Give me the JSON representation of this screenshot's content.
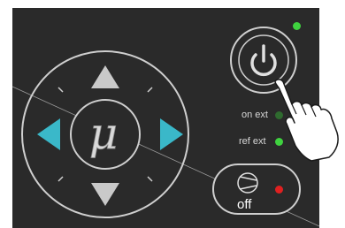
{
  "panel": {
    "background_color": "#2a2a2a",
    "mu_symbol": "μ",
    "indicators": [
      {
        "label": "on ext",
        "led_color": "#2f6b2f",
        "state": "off"
      },
      {
        "label": "ref ext",
        "led_color": "#3fd23f",
        "state": "on"
      }
    ],
    "power_led": {
      "color": "#3fd23f",
      "state": "on"
    },
    "compressor": {
      "label": "off",
      "led_color": "#e02020",
      "state": "on"
    },
    "colors": {
      "active_arrow": "#3ab8c9",
      "inactive_arrow": "#c9c9c9",
      "outline": "#d0d0d0"
    },
    "icons": [
      "power-icon",
      "compressor-icon",
      "pointing-hand-icon",
      "mu-icon"
    ]
  }
}
